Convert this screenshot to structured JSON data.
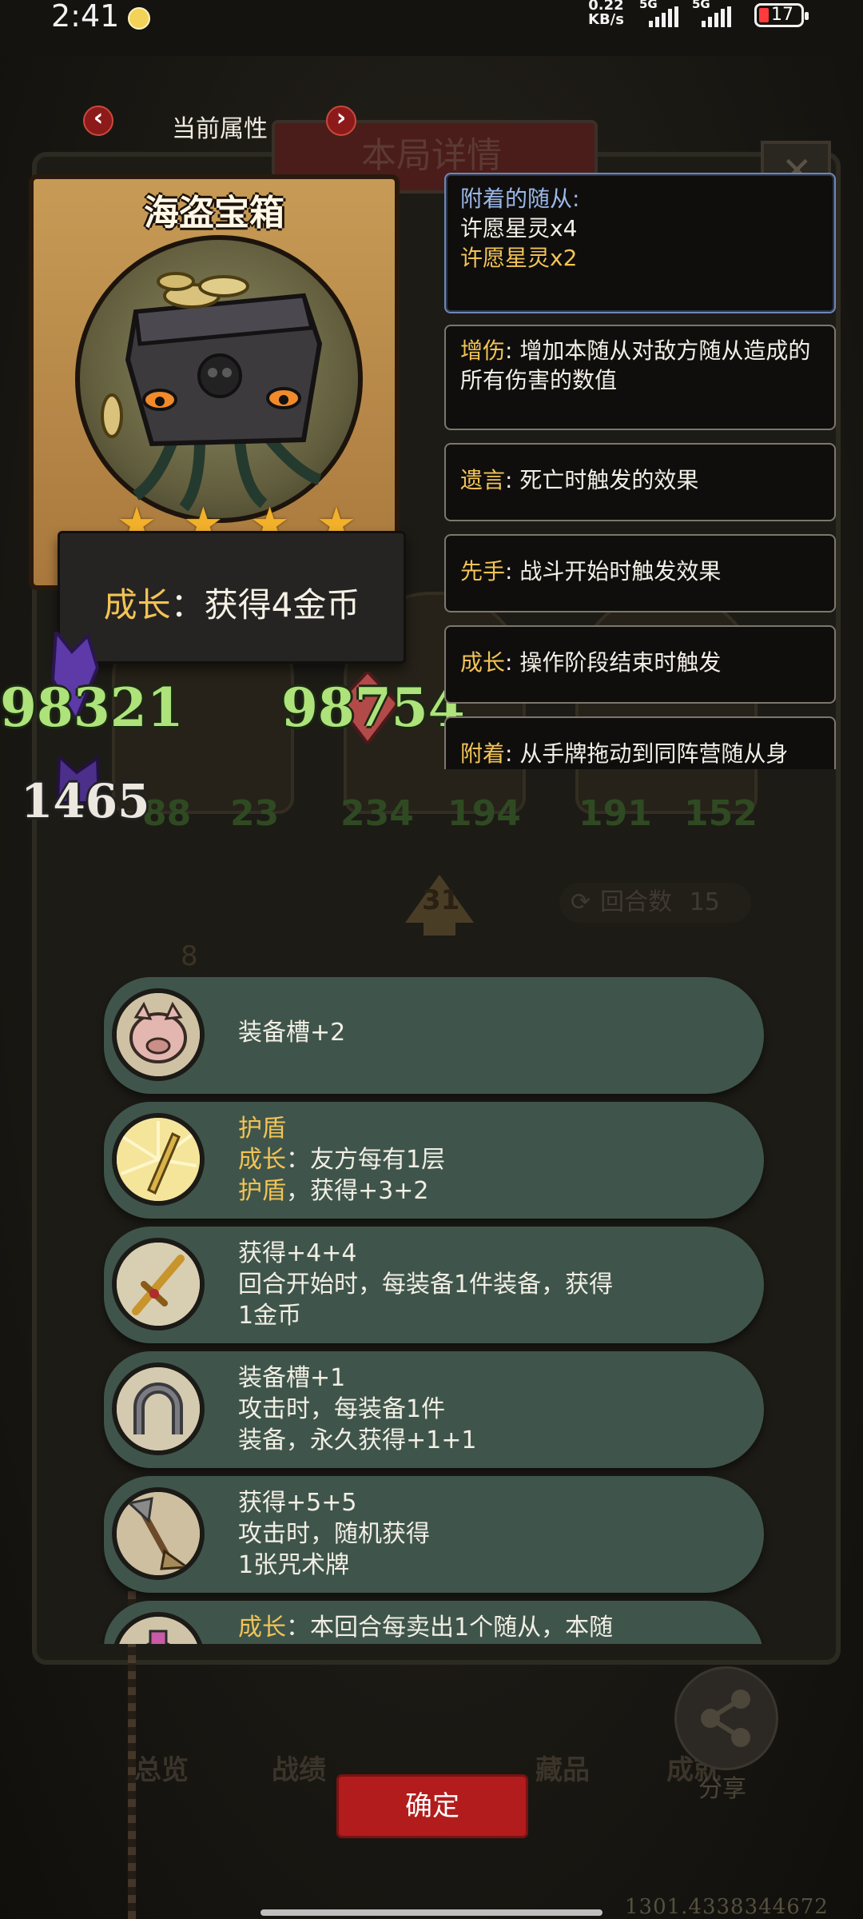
{
  "status_bar": {
    "time": "2:41",
    "net_speed_value": "0.22",
    "net_speed_unit": "KB/s",
    "signal1_label": "5G",
    "signal2_label": "5G",
    "battery": "17"
  },
  "background": {
    "title": "本局详情",
    "stats": [
      "88",
      "23",
      "234",
      "194",
      "191",
      "152"
    ],
    "arrow_value": "31",
    "rounds_label": "回合数",
    "rounds_value": "15",
    "level_badge": "8",
    "nav": [
      "总览",
      "战绩",
      "藏品",
      "成就"
    ],
    "share_label": "分享",
    "bottom_hint": "1301.4338344672"
  },
  "attribute_header": {
    "title": "当前属性",
    "prev": "‹",
    "next": "›"
  },
  "card": {
    "name": "海盗宝箱",
    "stars": 4,
    "growth_keyword": "成长",
    "growth_colon": "：",
    "growth_text": "获得4金币"
  },
  "floating_numbers": {
    "left": "98321",
    "right": "98754",
    "small": "1465"
  },
  "keyword_tips": [
    {
      "title": "附着的随从:",
      "line1": "许愿星灵x4",
      "line2": "许愿星灵x2"
    },
    {
      "keyword": "增伤",
      "text": ": 增加本随从对敌方随从造成的所有伤害的数值"
    },
    {
      "keyword": "遗言",
      "text": ": 死亡时触发的效果"
    },
    {
      "keyword": "先手",
      "text": ": 战斗开始时触发效果"
    },
    {
      "keyword": "成长",
      "text": ": 操作阶段结束时触发"
    },
    {
      "keyword": "附着",
      "text": ": 从手牌拖动到同阵营随从身"
    }
  ],
  "items": [
    {
      "icon": "pig-armor-icon",
      "lines": [
        {
          "plain": "装备槽+2"
        }
      ]
    },
    {
      "icon": "shield-sword-icon",
      "lines": [
        {
          "kw": "护盾"
        },
        {
          "kw": "成长",
          "plain": "：友方每有1层"
        },
        {
          "kw": "护盾",
          "plain": "，获得+3+2"
        }
      ]
    },
    {
      "icon": "golden-sword-icon",
      "lines": [
        {
          "plain": "获得+4+4"
        },
        {
          "plain": "回合开始时，每装备1件装备，获得"
        },
        {
          "plain": "1金币"
        }
      ]
    },
    {
      "icon": "horseshoe-icon",
      "lines": [
        {
          "plain": "装备槽+1"
        },
        {
          "plain": "攻击时，每装备1件"
        },
        {
          "plain": "装备，永久获得+1+1"
        }
      ]
    },
    {
      "icon": "broom-axe-icon",
      "lines": [
        {
          "plain": "获得+5+5"
        },
        {
          "plain": "攻击时，随机获得"
        },
        {
          "plain": "1张咒术牌"
        }
      ]
    },
    {
      "icon": "potion-icon",
      "lines": [
        {
          "kw": "成长",
          "plain": "：本回合每卖出1个随从，本随"
        }
      ]
    }
  ],
  "confirm": {
    "label": "确定"
  },
  "colors": {
    "accent_red": "#b21c1c",
    "keyword_gold": "#f2c356",
    "item_green": "#3f554b",
    "number_green": "#aee27a"
  }
}
